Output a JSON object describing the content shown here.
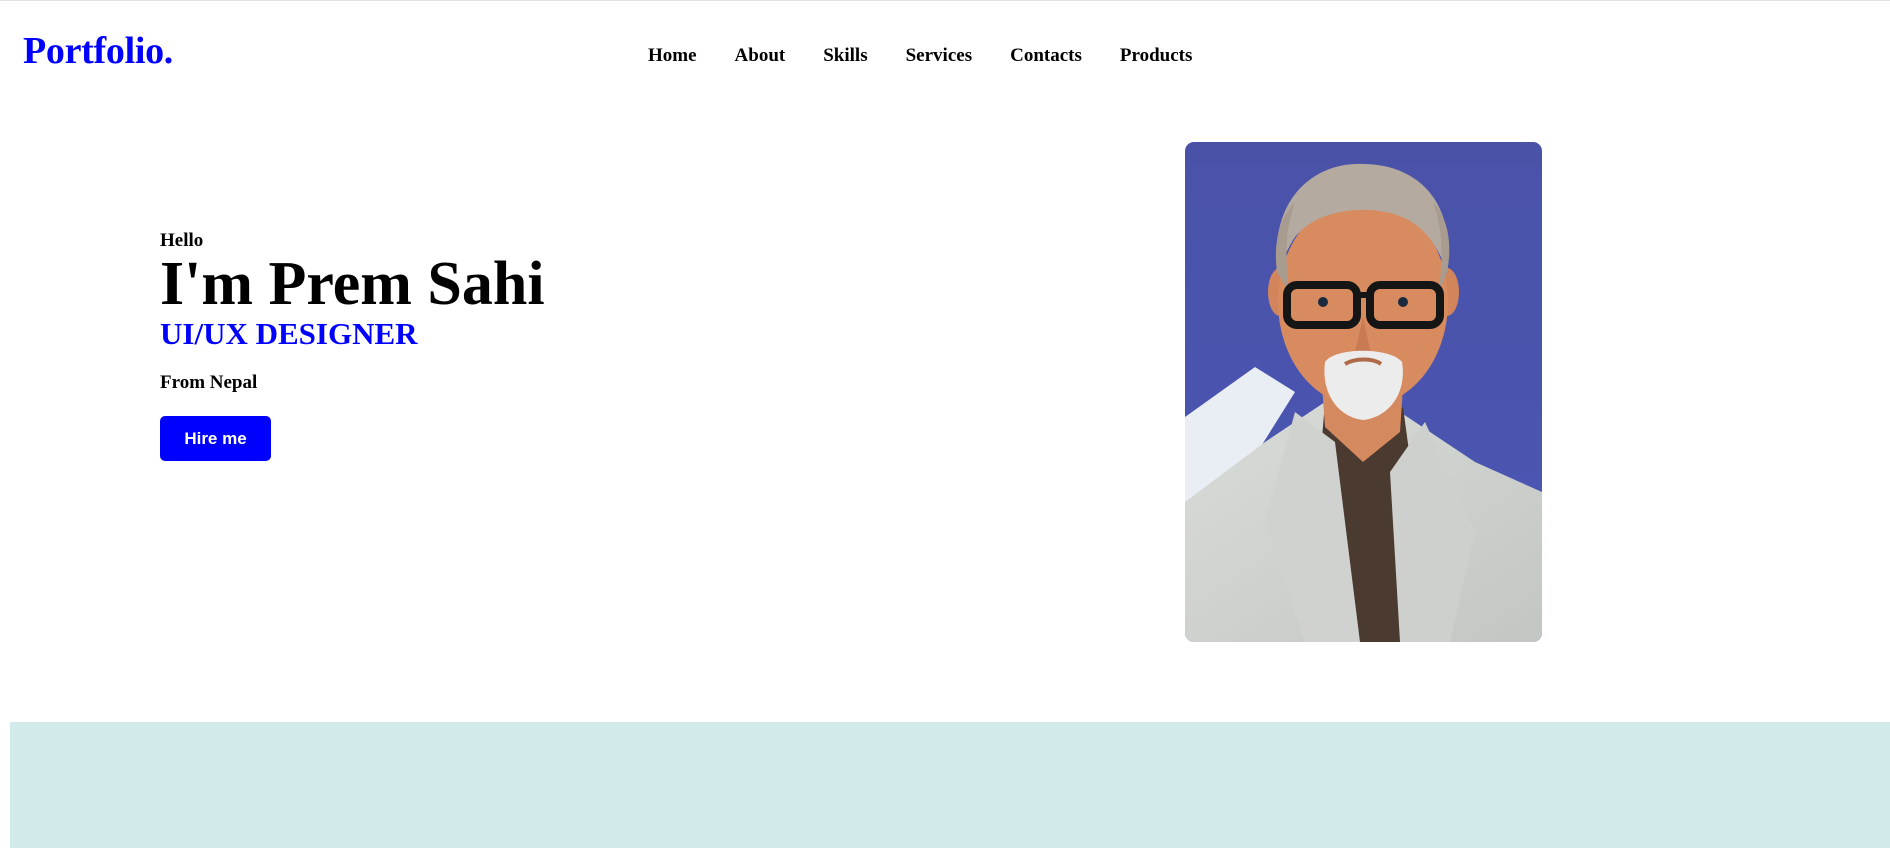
{
  "brand": {
    "logo": "Portfolio."
  },
  "nav": {
    "items": [
      {
        "label": "Home"
      },
      {
        "label": "About"
      },
      {
        "label": "Skills"
      },
      {
        "label": "Services"
      },
      {
        "label": "Contacts"
      },
      {
        "label": "Products"
      }
    ]
  },
  "hero": {
    "greeting": "Hello",
    "name": "I'm Prem Sahi",
    "role": "UI/UX DESIGNER",
    "location": "From Nepal",
    "cta_label": "Hire me"
  },
  "colors": {
    "accent": "#0000ff",
    "band": "#d3eaea",
    "photo_backdrop": "#4a54ae"
  }
}
